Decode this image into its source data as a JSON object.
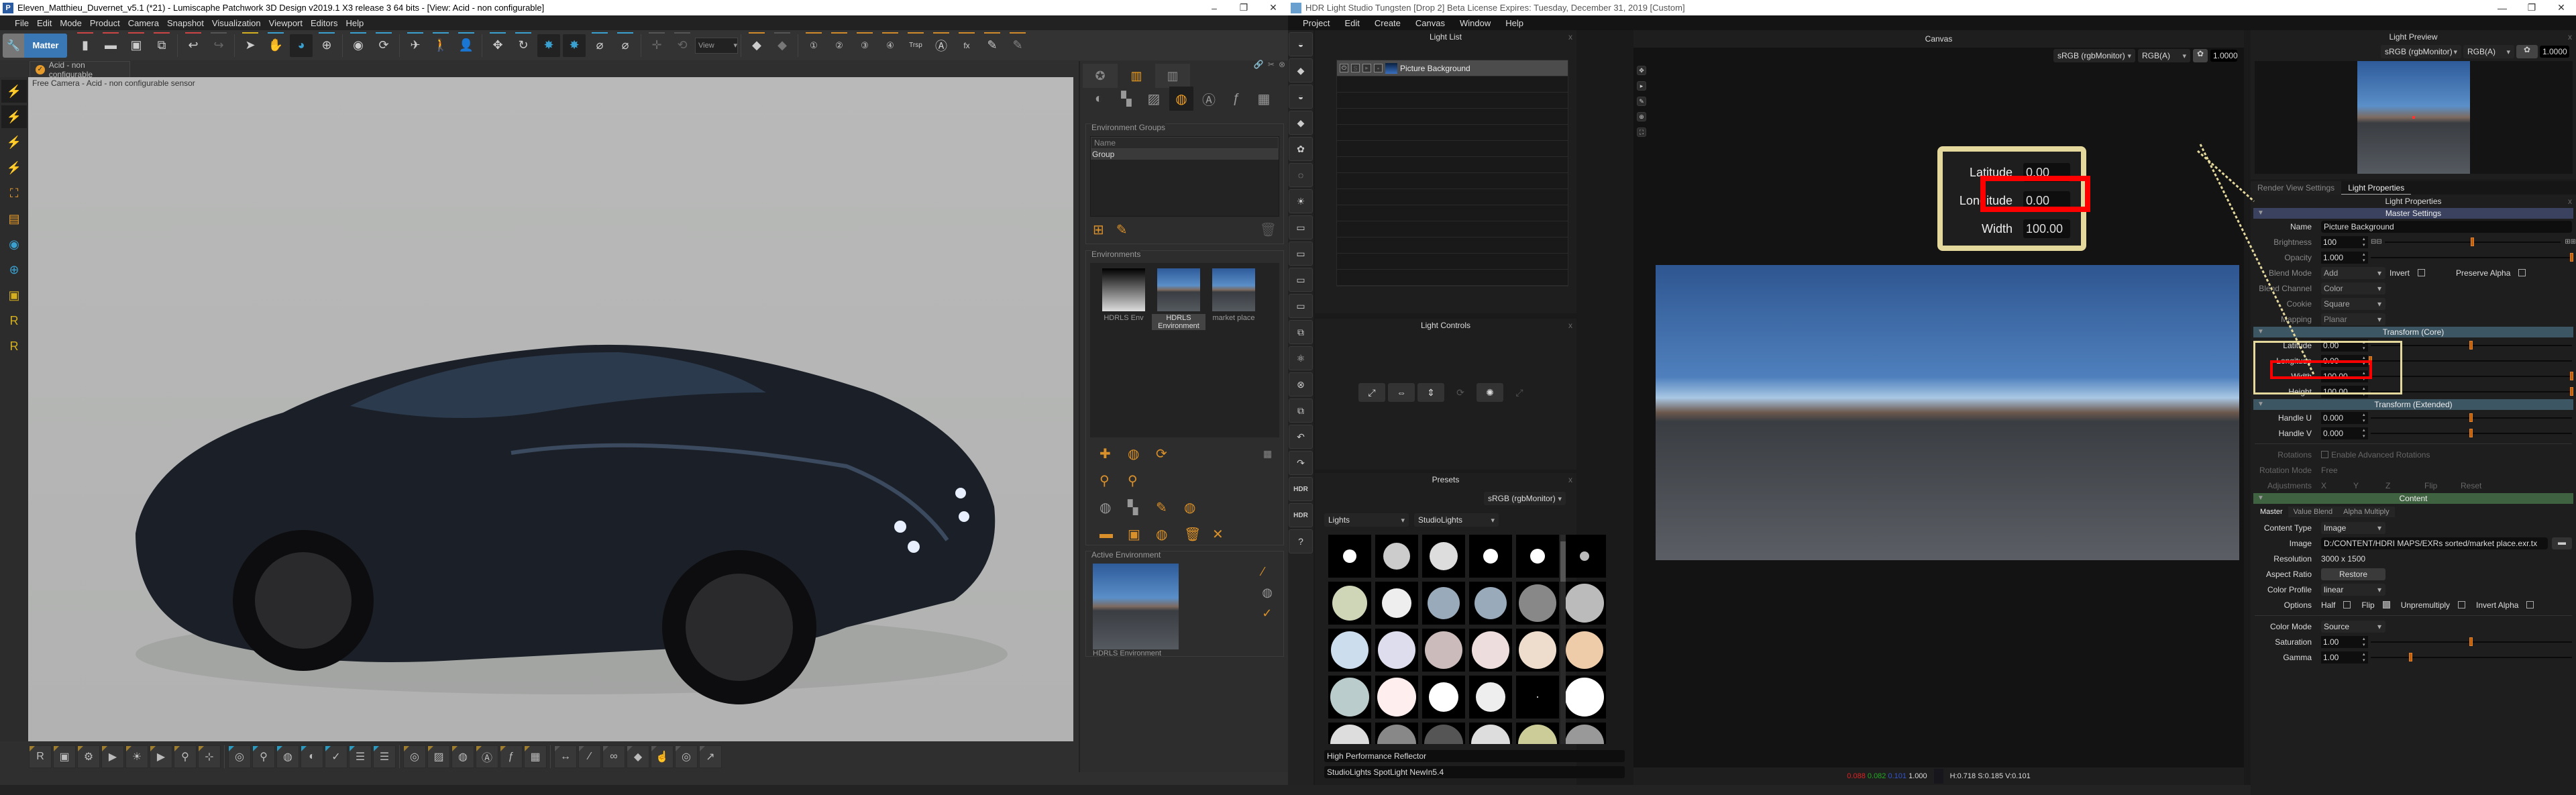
{
  "patchwork": {
    "title": "Eleven_Matthieu_Duvernet_v5.1 (*21) - Lumiscaphe Patchwork 3D Design v2019.1 X3 release 3  64 bits - [View: Acid - non configurable]",
    "menu": [
      "File",
      "Edit",
      "Mode",
      "Product",
      "Camera",
      "Snapshot",
      "Visualization",
      "Viewport",
      "Editors",
      "Help"
    ],
    "matter_label": "Matter",
    "view_select": "View",
    "toolbar_icons": [
      "new-file",
      "open-folder",
      "save",
      "save-as",
      "undo",
      "redo",
      "select-arrow",
      "pan-hand",
      "orbit",
      "zoom",
      "camera-shot",
      "camera-rotate",
      "fly-plane",
      "walk",
      "character",
      "move-pan",
      "rotate-globe",
      "pick-material",
      "pick-material-2",
      "eyedropper",
      "eyedropper-reset",
      "translate",
      "rotate",
      "prev",
      "next",
      "viewpoint-1",
      "viewpoint-2",
      "viewpoint-3",
      "viewpoint-4",
      "transparency",
      "animation",
      "fx",
      "brush",
      "brush-2"
    ],
    "trsp_label": "Trsp",
    "viewport_tab": "Acid - non configurable",
    "viewport_label": "Free Camera - Acid - non configurable sensor",
    "library": {
      "env_groups_title": "Environment Groups",
      "name_header": "Name",
      "groups": [
        "Group"
      ],
      "environments_title": "Environments",
      "environments": [
        {
          "label": "HDRLS Env",
          "selected": false
        },
        {
          "label": "HDRLS Environment",
          "selected": true
        },
        {
          "label": "market place",
          "selected": false
        }
      ],
      "active_env_title": "Active Environment",
      "active_env_label": "HDRLS Environment"
    }
  },
  "hls": {
    "title": "HDR Light Studio Tungsten [Drop 2] Beta License Expires: Tuesday, December 31, 2019  [Custom]",
    "menu": [
      "Project",
      "Edit",
      "Create",
      "Canvas",
      "Window",
      "Help"
    ],
    "light_list_title": "Light List",
    "light_item": "Picture Background",
    "light_controls_title": "Light Controls",
    "presets_title": "Presets",
    "presets_colorspace": "sRGB (rgbMonitor)",
    "presets_category": "Lights",
    "presets_library": "StudioLights",
    "preset_name": "High Performance Reflector",
    "preset_library_name": "StudioLights SpotLight NewIn5.4",
    "canvas_title": "Canvas",
    "canvas_colorspace": "sRGB (rgbMonitor)",
    "canvas_channel": "RGB(A)",
    "canvas_exposure": "1.0000",
    "status": {
      "r": "0.088",
      "g": "0.082",
      "b": "0.101",
      "a": "1.000",
      "hsv": "H:0.718 S:0.185 V:0.101"
    },
    "preview_title": "Light Preview",
    "preview_colorspace": "sRGB (rgbMonitor)",
    "preview_channel": "RGB(A)",
    "preview_exposure": "1.0000",
    "tabs": [
      "Render View Settings",
      "Light Properties"
    ],
    "props_title": "Light Properties",
    "master": {
      "header": "Master Settings",
      "name_label": "Name",
      "name": "Picture Background",
      "brightness_label": "Brightness",
      "brightness": "100",
      "brightness_pos": 0.5,
      "opacity_label": "Opacity",
      "opacity": "1.000",
      "opacity_pos": 1.0,
      "blend_mode_label": "Blend Mode",
      "blend_mode": "Add",
      "invert_label": "Invert",
      "preserve_alpha_label": "Preserve Alpha",
      "blend_channel_label": "Blend Channel",
      "blend_channel": "Color",
      "cookie_label": "Cookie",
      "cookie": "Square",
      "mapping_label": "Mapping",
      "mapping": "Planar"
    },
    "transform_core": {
      "header": "Transform (Core)",
      "rows": [
        {
          "label": "Latitude",
          "value": "0.00",
          "pos": 0.5
        },
        {
          "label": "Longitude",
          "value": "0.00",
          "pos": 0.0
        },
        {
          "label": "Width",
          "value": "100.00",
          "pos": 1.0
        },
        {
          "label": "Height",
          "value": "100.00",
          "pos": 1.0
        }
      ]
    },
    "transform_ext": {
      "header": "Transform (Extended)",
      "rows": [
        {
          "label": "Handle U",
          "value": "0.000",
          "pos": 0.5
        },
        {
          "label": "Handle V",
          "value": "0.000",
          "pos": 0.5
        }
      ],
      "rotations_label": "Rotations",
      "advanced_label": "Enable Advanced Rotations",
      "rotation_mode_label": "Rotation Mode",
      "rotation_mode": "Free",
      "adjustments_label": "Adjustments",
      "adj": [
        "X",
        "Y",
        "Z"
      ],
      "flip": "Flip",
      "reset": "Reset"
    },
    "content": {
      "header": "Content",
      "tabs": [
        "Master",
        "Value Blend",
        "Alpha Multiply"
      ],
      "content_type_label": "Content Type",
      "content_type": "Image",
      "image_label": "Image",
      "image": "D:/CONTENT/HDRI MAPS/EXRs sorted/market place.exr.tx",
      "resolution_label": "Resolution",
      "resolution": "3000 x 1500",
      "aspect_label": "Aspect Ratio",
      "restore": "Restore",
      "color_profile_label": "Color Profile",
      "color_profile": "linear",
      "options_label": "Options",
      "half": "Half",
      "flip": "Flip",
      "unpremultiply": "Unpremultiply",
      "invert_alpha": "Invert Alpha",
      "color_mode_label": "Color Mode",
      "color_mode": "Source",
      "saturation_label": "Saturation",
      "saturation": "1.00",
      "saturation_pos": 0.5,
      "gamma_label": "Gamma",
      "gamma": "1.00",
      "gamma_pos": 0.2
    },
    "callout": {
      "latitude": "Latitude",
      "latitude_val": "0.00",
      "longitude": "Longitude",
      "longitude_val": "0.00",
      "width": "Width",
      "width_val": "100.00"
    }
  }
}
